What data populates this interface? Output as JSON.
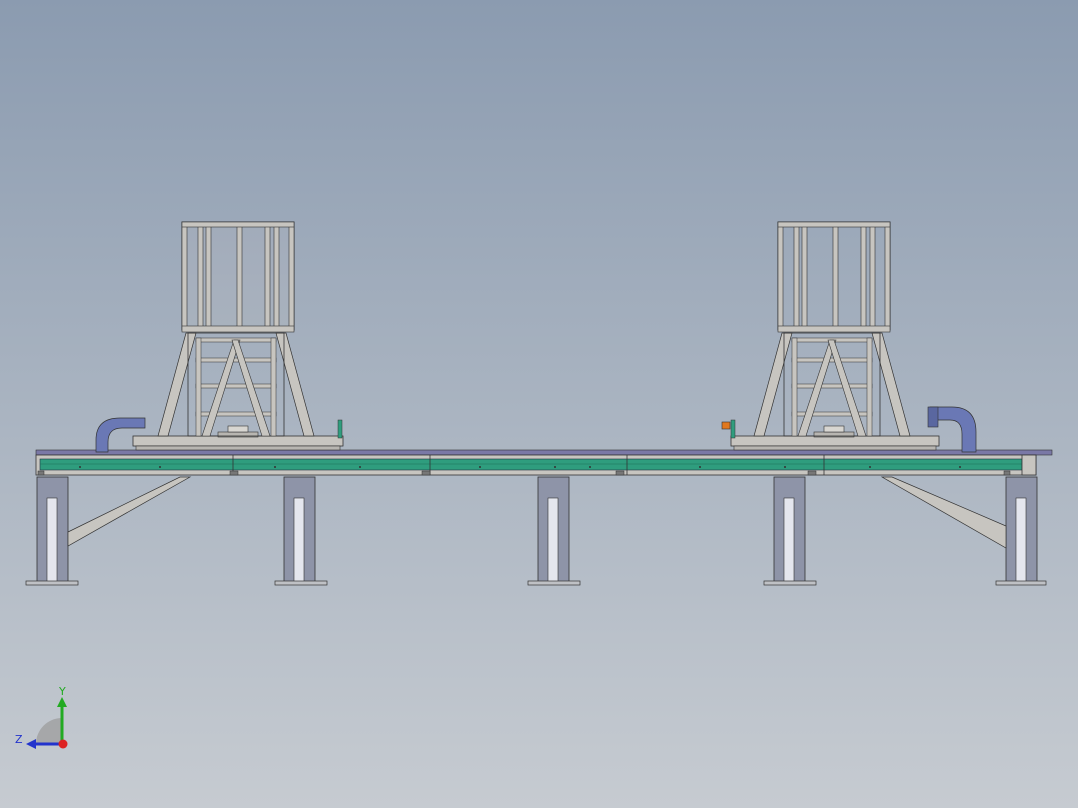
{
  "viewport": {
    "background_top": "#8b9bb0",
    "background_bottom": "#c6cbd1"
  },
  "model": {
    "frame_color": "#c7c5c0",
    "rail_color": "#2f9d7e",
    "rail_top_color": "#7a78a6",
    "post_color": "#8e94a8",
    "cable_chain_color": "#6a78b5",
    "stops": [
      {
        "name": "left-robot-stand"
      },
      {
        "name": "right-robot-stand"
      }
    ]
  },
  "triad": {
    "y_label": "Y",
    "z_label": "Z",
    "y_color": "#22aa22",
    "z_color": "#2233cc",
    "x_color": "#dd2222"
  }
}
